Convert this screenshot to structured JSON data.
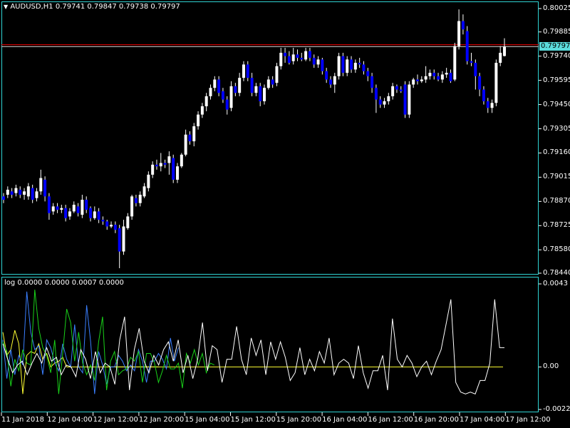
{
  "header": {
    "arrow_icon": "triangle-down-icon",
    "symbol": "AUDUSD,H1",
    "ohlc": "0.79741 0.79847 0.79738 0.79797"
  },
  "indicator": {
    "label": "log 0.0000 0.0000 0.0007 0.0000"
  },
  "current_price": "0.79797",
  "price_axis": [
    "0.80025",
    "0.79885",
    "0.79740",
    "0.79595",
    "0.79450",
    "0.79305",
    "0.79160",
    "0.79015",
    "0.78870",
    "0.78725",
    "0.78580",
    "0.78440"
  ],
  "indicator_axis": [
    "0.0043",
    "0.00",
    "-0.0022"
  ],
  "time_axis": [
    "11 Jan 2018",
    "12 Jan 04:00",
    "12 Jan 12:00",
    "12 Jan 20:00",
    "15 Jan 04:00",
    "15 Jan 12:00",
    "15 Jan 20:00",
    "16 Jan 04:00",
    "16 Jan 12:00",
    "16 Jan 20:00",
    "17 Jan 04:00",
    "17 Jan 12:00"
  ],
  "colors": {
    "bull": "#ffffff",
    "bear": "#0000ff",
    "border": "#2fd4d4",
    "ask": "#ff0000",
    "bid": "#cccccc",
    "ind_white": "#ffffff",
    "ind_green": "#19d219",
    "ind_blue": "#3a7fff",
    "ind_yellow": "#ffff33"
  },
  "chart_data": {
    "type": "candlestick",
    "price_range": [
      0.7844,
      0.8005
    ],
    "ask_line": 0.79808,
    "bid_line": 0.79797,
    "candles": [
      [
        0.789,
        0.7888,
        0.7886,
        0.7892
      ],
      [
        0.7891,
        0.7894,
        0.7889,
        0.7896
      ],
      [
        0.7893,
        0.7891,
        0.7889,
        0.7895
      ],
      [
        0.7892,
        0.7895,
        0.789,
        0.7897
      ],
      [
        0.7894,
        0.7891,
        0.7889,
        0.7896
      ],
      [
        0.7891,
        0.7893,
        0.7888,
        0.7895
      ],
      [
        0.789,
        0.7896,
        0.7888,
        0.7898
      ],
      [
        0.7895,
        0.7888,
        0.7886,
        0.7897
      ],
      [
        0.7889,
        0.7893,
        0.7887,
        0.7895
      ],
      [
        0.7893,
        0.7901,
        0.7891,
        0.7906
      ],
      [
        0.79,
        0.789,
        0.7887,
        0.7902
      ],
      [
        0.789,
        0.788,
        0.7876,
        0.7892
      ],
      [
        0.7881,
        0.7884,
        0.7879,
        0.7886
      ],
      [
        0.7884,
        0.7882,
        0.788,
        0.7886
      ],
      [
        0.7882,
        0.7883,
        0.788,
        0.7885
      ],
      [
        0.7883,
        0.7877,
        0.7875,
        0.7885
      ],
      [
        0.7878,
        0.7881,
        0.7876,
        0.7883
      ],
      [
        0.7881,
        0.7885,
        0.788,
        0.7887
      ],
      [
        0.7884,
        0.788,
        0.7878,
        0.7886
      ],
      [
        0.7879,
        0.7888,
        0.7877,
        0.7891
      ],
      [
        0.7888,
        0.7882,
        0.788,
        0.789
      ],
      [
        0.7883,
        0.7877,
        0.7875,
        0.7884
      ],
      [
        0.7877,
        0.7881,
        0.7876,
        0.7884
      ],
      [
        0.7881,
        0.7876,
        0.7874,
        0.7883
      ],
      [
        0.7876,
        0.7875,
        0.7873,
        0.7878
      ],
      [
        0.7875,
        0.7872,
        0.787,
        0.7876
      ],
      [
        0.7872,
        0.7873,
        0.7871,
        0.7875
      ],
      [
        0.7873,
        0.787,
        0.7868,
        0.7875
      ],
      [
        0.7871,
        0.7857,
        0.7847,
        0.7873
      ],
      [
        0.7857,
        0.7872,
        0.7855,
        0.7876
      ],
      [
        0.7871,
        0.7878,
        0.787,
        0.788
      ],
      [
        0.7878,
        0.789,
        0.7876,
        0.7891
      ],
      [
        0.7889,
        0.7886,
        0.7884,
        0.7891
      ],
      [
        0.7886,
        0.7891,
        0.7884,
        0.7893
      ],
      [
        0.789,
        0.7896,
        0.7889,
        0.7898
      ],
      [
        0.7895,
        0.7903,
        0.7893,
        0.7905
      ],
      [
        0.7903,
        0.7909,
        0.7901,
        0.7911
      ],
      [
        0.7909,
        0.7908,
        0.7906,
        0.7912
      ],
      [
        0.7908,
        0.791,
        0.7905,
        0.7916
      ],
      [
        0.791,
        0.7909,
        0.7907,
        0.7912
      ],
      [
        0.791,
        0.7914,
        0.7903,
        0.7917
      ],
      [
        0.7913,
        0.79,
        0.7898,
        0.7915
      ],
      [
        0.79,
        0.7908,
        0.7898,
        0.791
      ],
      [
        0.7908,
        0.7915,
        0.7907,
        0.7916
      ],
      [
        0.7915,
        0.7927,
        0.7914,
        0.793
      ],
      [
        0.7927,
        0.7923,
        0.7921,
        0.7929
      ],
      [
        0.7923,
        0.7932,
        0.792,
        0.7934
      ],
      [
        0.7932,
        0.7939,
        0.793,
        0.7941
      ],
      [
        0.7939,
        0.7944,
        0.7937,
        0.7946
      ],
      [
        0.7944,
        0.795,
        0.7941,
        0.7952
      ],
      [
        0.795,
        0.7955,
        0.7948,
        0.7957
      ],
      [
        0.7955,
        0.796,
        0.7953,
        0.7962
      ],
      [
        0.796,
        0.7952,
        0.795,
        0.7962
      ],
      [
        0.7953,
        0.7948,
        0.7946,
        0.7955
      ],
      [
        0.7948,
        0.7942,
        0.7939,
        0.795
      ],
      [
        0.7943,
        0.7956,
        0.7941,
        0.7959
      ],
      [
        0.7956,
        0.7952,
        0.795,
        0.7958
      ],
      [
        0.7952,
        0.7961,
        0.795,
        0.7964
      ],
      [
        0.7961,
        0.7969,
        0.7959,
        0.7971
      ],
      [
        0.7969,
        0.7961,
        0.7959,
        0.7971
      ],
      [
        0.7961,
        0.7952,
        0.795,
        0.7964
      ],
      [
        0.7952,
        0.7956,
        0.795,
        0.7958
      ],
      [
        0.7956,
        0.7947,
        0.7944,
        0.7958
      ],
      [
        0.7947,
        0.7955,
        0.7945,
        0.7957
      ],
      [
        0.7955,
        0.796,
        0.7954,
        0.7962
      ],
      [
        0.796,
        0.7957,
        0.7955,
        0.7962
      ],
      [
        0.7958,
        0.7968,
        0.7956,
        0.797
      ],
      [
        0.7968,
        0.7976,
        0.7966,
        0.7979
      ],
      [
        0.7976,
        0.7974,
        0.797,
        0.7979
      ],
      [
        0.7974,
        0.797,
        0.7969,
        0.7977
      ],
      [
        0.7971,
        0.7975,
        0.7969,
        0.7979
      ],
      [
        0.7975,
        0.7973,
        0.7971,
        0.7978
      ],
      [
        0.7973,
        0.7972,
        0.7971,
        0.7976
      ],
      [
        0.7972,
        0.7977,
        0.7971,
        0.7979
      ],
      [
        0.7977,
        0.7973,
        0.7971,
        0.7979
      ],
      [
        0.7973,
        0.7969,
        0.7967,
        0.7975
      ],
      [
        0.7969,
        0.7972,
        0.7967,
        0.7974
      ],
      [
        0.7972,
        0.7965,
        0.7963,
        0.7973
      ],
      [
        0.7965,
        0.796,
        0.7958,
        0.7967
      ],
      [
        0.796,
        0.7957,
        0.7955,
        0.7962
      ],
      [
        0.7957,
        0.7962,
        0.7952,
        0.7964
      ],
      [
        0.7962,
        0.7974,
        0.796,
        0.7976
      ],
      [
        0.7974,
        0.7964,
        0.7962,
        0.7976
      ],
      [
        0.7964,
        0.7972,
        0.7962,
        0.7974
      ],
      [
        0.7972,
        0.7966,
        0.7964,
        0.7974
      ],
      [
        0.7966,
        0.797,
        0.7964,
        0.7972
      ],
      [
        0.797,
        0.7969,
        0.7967,
        0.7973
      ],
      [
        0.7969,
        0.7965,
        0.7963,
        0.7971
      ],
      [
        0.7965,
        0.7962,
        0.7959,
        0.7967
      ],
      [
        0.7962,
        0.7955,
        0.7952,
        0.7964
      ],
      [
        0.7955,
        0.7948,
        0.794,
        0.7957
      ],
      [
        0.7948,
        0.7945,
        0.7943,
        0.795
      ],
      [
        0.7945,
        0.7947,
        0.7943,
        0.7949
      ],
      [
        0.7947,
        0.795,
        0.7945,
        0.7952
      ],
      [
        0.795,
        0.7956,
        0.7948,
        0.7958
      ],
      [
        0.7956,
        0.7954,
        0.7952,
        0.7957
      ],
      [
        0.7954,
        0.7953,
        0.7952,
        0.7956
      ],
      [
        0.7957,
        0.7939,
        0.7937,
        0.7959
      ],
      [
        0.7939,
        0.7957,
        0.7937,
        0.7959
      ],
      [
        0.7957,
        0.796,
        0.7955,
        0.7961
      ],
      [
        0.796,
        0.7959,
        0.7957,
        0.7963
      ],
      [
        0.7959,
        0.796,
        0.7958,
        0.7962
      ],
      [
        0.796,
        0.7962,
        0.7958,
        0.7968
      ],
      [
        0.7962,
        0.7964,
        0.796,
        0.7966
      ],
      [
        0.7964,
        0.7962,
        0.796,
        0.7966
      ],
      [
        0.7962,
        0.796,
        0.7959,
        0.7964
      ],
      [
        0.796,
        0.7963,
        0.7958,
        0.7965
      ],
      [
        0.7963,
        0.7964,
        0.7961,
        0.7967
      ],
      [
        0.7964,
        0.7959,
        0.7958,
        0.7966
      ],
      [
        0.796,
        0.798,
        0.7959,
        0.7982
      ],
      [
        0.798,
        0.7995,
        0.7978,
        0.8002
      ],
      [
        0.7995,
        0.799,
        0.7987,
        0.7999
      ],
      [
        0.7989,
        0.7971,
        0.7969,
        0.7992
      ],
      [
        0.7971,
        0.797,
        0.7968,
        0.7976
      ],
      [
        0.797,
        0.7962,
        0.7954,
        0.7972
      ],
      [
        0.7962,
        0.7954,
        0.795,
        0.7964
      ],
      [
        0.7954,
        0.7947,
        0.7945,
        0.7956
      ],
      [
        0.7947,
        0.7943,
        0.794,
        0.7949
      ],
      [
        0.7943,
        0.7946,
        0.794,
        0.7948
      ],
      [
        0.7946,
        0.797,
        0.7944,
        0.7972
      ],
      [
        0.797,
        0.7976,
        0.7968,
        0.798
      ],
      [
        0.79741,
        0.79797,
        0.79738,
        0.79847
      ]
    ],
    "indicator": {
      "range": [
        -0.0022,
        0.0043
      ],
      "zero_line": 0.0,
      "white": [
        0.0012,
        0.0004,
        -0.0003,
        0.0001,
        0.0003,
        -0.0004,
        0.0002,
        0.0007,
        0.0002,
        0.001,
        0.0003,
        0.0005,
        -0.0004,
        0.0001,
        0.0,
        -0.0005,
        0.0009,
        0.0004,
        -0.0006,
        0.0008,
        -0.0003,
        0.0002,
        0.0,
        -0.0009,
        0.0014,
        0.0026,
        -0.0012,
        0.0009,
        0.002,
        0.0003,
        -0.0003,
        0.0006,
        0.0001,
        0.0009,
        0.0013,
        0.0003,
        0.0014,
        -0.0003,
        0.0006,
        -0.0006,
        0.0004,
        0.0023,
        -0.0002,
        0.0011,
        0.0009,
        -0.0008,
        0.0004,
        0.0004,
        0.0021,
        0.0004,
        -0.0004,
        0.0015,
        0.0006,
        0.0014,
        -0.0004,
        0.0013,
        0.0004,
        0.0013,
        0.0005,
        -0.0007,
        -0.0003,
        0.001,
        -0.0004,
        0.0004,
        -0.0002,
        0.0008,
        0.0002,
        0.0015,
        -0.0004,
        0.0002,
        0.0004,
        0.0002,
        -0.0006,
        0.0011,
        -0.0003,
        -0.0011,
        -0.0002,
        -0.0002,
        0.0006,
        -0.0012,
        0.0025,
        0.0004,
        0.0,
        0.0006,
        0.0002,
        -0.0005,
        0.0,
        0.0003,
        -0.0004,
        0.0003,
        0.0009,
        0.0022,
        0.0035,
        -0.0008,
        -0.0013,
        -0.0014,
        -0.0013,
        -0.0014,
        -0.0007,
        -0.0007,
        0.0002,
        0.0035,
        0.001,
        0.001
      ],
      "green": [
        0.0013,
        0.0008,
        -0.001,
        0.0004,
        -0.0002,
        0.0009,
        0.0002,
        0.0001,
        0.004,
        0.002,
        0.001,
        0.0006,
        -0.0003,
        0.0014,
        -0.0014,
        0.0007,
        0.003,
        0.0023,
        0.0003,
        0.0018,
        0.0002,
        -0.0004,
        0.0001,
        -0.0007,
        0.0013,
        0.0026,
        -0.0012,
        0.0003,
        0.0008,
        -0.0004,
        -0.0002,
        -0.0001,
        0.0005,
        0.0003,
        0.0008,
        -0.0008,
        0.0007,
        0.0007,
        0.0002,
        -0.0008,
        -0.0002,
        0.0006,
        -0.0001,
        -0.0001,
        0.0002,
        -0.0011,
        0.0007,
        0.0002,
        0.0009,
        0.0001,
        0.0007,
        -0.0003,
        0.0002,
        0.0001
      ],
      "blue": [
        0.0014,
        -0.0006,
        0.0009,
        -0.0004,
        0.0006,
        0.0001,
        0.0039,
        0.0018,
        0.0009,
        0.0011,
        -0.0004,
        0.0014,
        0.001,
        0.0002,
        -0.0002,
        0.0012,
        0.0004,
        0.0,
        0.0022,
        0.0,
        -0.0003,
        0.0032,
        0.0013,
        -0.0014,
        0.0008,
        0.0001,
        -0.0009,
        0.0,
        0.0,
        0.0006,
        0.0003,
        -0.0002,
        0.0001,
        -0.0002,
        0.0009,
        0.0003,
        -0.0008,
        0.0003,
        0.0003,
        0.0007,
        0.0004,
        -0.0001,
        0.0015,
        0.0003,
        0.001
      ],
      "yellow": [
        0.0018,
        0.0006,
        0.0009,
        0.0019,
        0.0012,
        -0.0014,
        0.0006,
        0.0008,
        0.0007,
        0.0012,
        0.0004,
        0.0007,
        0.0,
        0.0002,
        0.0003,
        0.0005,
        0.0,
        0.0,
        0.0,
        0.0,
        0.0,
        0.0,
        0.0,
        0.0,
        0.0,
        0.0,
        0.0,
        0.0,
        0.0,
        0.0,
        0.0,
        0.0,
        0.0,
        0.0,
        0.0,
        0.0,
        0.0,
        0.0,
        0.0,
        0.0,
        0.0,
        0.0,
        0.0,
        0.0,
        0.0,
        0.0,
        0.0,
        0.0,
        0.0,
        0.0,
        0.0,
        0.0,
        0.0,
        0.0,
        0.0,
        0.0,
        0.0,
        0.0,
        0.0,
        0.0,
        0.0,
        0.0,
        0.0,
        0.0,
        0.0,
        0.0,
        0.0,
        0.0,
        0.0,
        0.0,
        0.0,
        0.0,
        0.0,
        0.0,
        0.0,
        0.0,
        0.0,
        0.0,
        0.0,
        0.0,
        0.0,
        0.0,
        0.0,
        0.0,
        0.0,
        0.0,
        0.0,
        0.0,
        0.0,
        0.0,
        0.0,
        0.0,
        0.0,
        0.0,
        0.0,
        0.0,
        0.0,
        0.0,
        0.0
      ]
    }
  }
}
